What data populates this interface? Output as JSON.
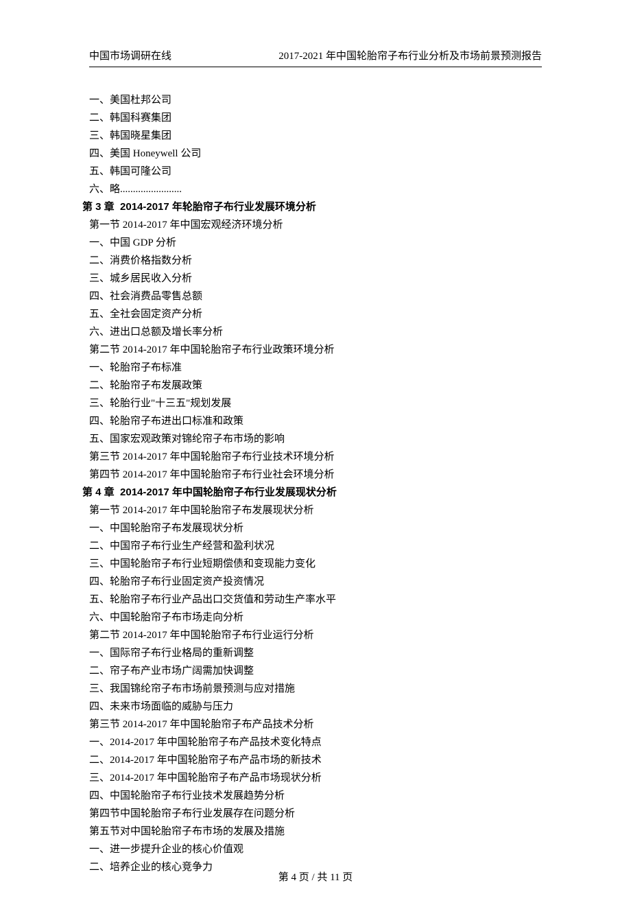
{
  "header": {
    "left": "中国市场调研在线",
    "right": "2017-2021 年中国轮胎帘子布行业分析及市场前景预测报告"
  },
  "lines": [
    {
      "text": "一、美国杜邦公司",
      "bold": false,
      "heading": false
    },
    {
      "text": "二、韩国科赛集团",
      "bold": false,
      "heading": false
    },
    {
      "text": "三、韩国晓星集团",
      "bold": false,
      "heading": false
    },
    {
      "text": "四、美国 Honeywell 公司",
      "bold": false,
      "heading": false
    },
    {
      "text": "五、韩国可隆公司",
      "bold": false,
      "heading": false
    },
    {
      "text": "六、略........................",
      "bold": false,
      "heading": false
    },
    {
      "text": "第 3 章  2014-2017 年轮胎帘子布行业发展环境分析",
      "bold": true,
      "heading": true
    },
    {
      "text": "第一节 2014-2017 年中国宏观经济环境分析",
      "bold": false,
      "heading": false
    },
    {
      "text": "一、中国 GDP 分析",
      "bold": false,
      "heading": false
    },
    {
      "text": "二、消费价格指数分析",
      "bold": false,
      "heading": false
    },
    {
      "text": "三、城乡居民收入分析",
      "bold": false,
      "heading": false
    },
    {
      "text": "四、社会消费品零售总额",
      "bold": false,
      "heading": false
    },
    {
      "text": "五、全社会固定资产分析",
      "bold": false,
      "heading": false
    },
    {
      "text": "六、进出口总额及增长率分析",
      "bold": false,
      "heading": false
    },
    {
      "text": "第二节 2014-2017 年中国轮胎帘子布行业政策环境分析",
      "bold": false,
      "heading": false
    },
    {
      "text": "一、轮胎帘子布标准",
      "bold": false,
      "heading": false
    },
    {
      "text": "二、轮胎帘子布发展政策",
      "bold": false,
      "heading": false
    },
    {
      "text": "三、轮胎行业\"十三五\"规划发展",
      "bold": false,
      "heading": false
    },
    {
      "text": "四、轮胎帘子布进出口标准和政策",
      "bold": false,
      "heading": false
    },
    {
      "text": "五、国家宏观政策对锦纶帘子布市场的影响",
      "bold": false,
      "heading": false
    },
    {
      "text": "第三节 2014-2017 年中国轮胎帘子布行业技术环境分析",
      "bold": false,
      "heading": false
    },
    {
      "text": "第四节 2014-2017 年中国轮胎帘子布行业社会环境分析",
      "bold": false,
      "heading": false
    },
    {
      "text": "第 4 章  2014-2017 年中国轮胎帘子布行业发展现状分析",
      "bold": true,
      "heading": true
    },
    {
      "text": "第一节 2014-2017 年中国轮胎帘子布发展现状分析",
      "bold": false,
      "heading": false
    },
    {
      "text": "一、中国轮胎帘子布发展现状分析",
      "bold": false,
      "heading": false
    },
    {
      "text": "二、中国帘子布行业生产经营和盈利状况",
      "bold": false,
      "heading": false
    },
    {
      "text": "三、中国轮胎帘子布行业短期偿债和变现能力变化",
      "bold": false,
      "heading": false
    },
    {
      "text": "四、轮胎帘子布行业固定资产投资情况",
      "bold": false,
      "heading": false
    },
    {
      "text": "五、轮胎帘子布行业产品出口交货值和劳动生产率水平",
      "bold": false,
      "heading": false
    },
    {
      "text": "六、中国轮胎帘子布市场走向分析",
      "bold": false,
      "heading": false
    },
    {
      "text": "第二节 2014-2017 年中国轮胎帘子布行业运行分析",
      "bold": false,
      "heading": false
    },
    {
      "text": "一、国际帘子布行业格局的重新调整",
      "bold": false,
      "heading": false
    },
    {
      "text": "二、帘子布产业市场广阔需加快调整",
      "bold": false,
      "heading": false
    },
    {
      "text": "三、我国锦纶帘子布市场前景预测与应对措施",
      "bold": false,
      "heading": false
    },
    {
      "text": "四、未来市场面临的威胁与压力",
      "bold": false,
      "heading": false
    },
    {
      "text": "第三节 2014-2017 年中国轮胎帘子布产品技术分析",
      "bold": false,
      "heading": false
    },
    {
      "text": "一、2014-2017 年中国轮胎帘子布产品技术变化特点",
      "bold": false,
      "heading": false
    },
    {
      "text": "二、2014-2017 年中国轮胎帘子布产品市场的新技术",
      "bold": false,
      "heading": false
    },
    {
      "text": "三、2014-2017 年中国轮胎帘子布产品市场现状分析",
      "bold": false,
      "heading": false
    },
    {
      "text": "四、中国轮胎帘子布行业技术发展趋势分析",
      "bold": false,
      "heading": false
    },
    {
      "text": "第四节中国轮胎帘子布行业发展存在问题分析",
      "bold": false,
      "heading": false
    },
    {
      "text": "第五节对中国轮胎帘子布市场的发展及措施",
      "bold": false,
      "heading": false
    },
    {
      "text": "一、进一步提升企业的核心价值观",
      "bold": false,
      "heading": false
    },
    {
      "text": "二、培养企业的核心竞争力",
      "bold": false,
      "heading": false
    }
  ],
  "footer": {
    "text": "第 4 页 / 共 11 页"
  }
}
